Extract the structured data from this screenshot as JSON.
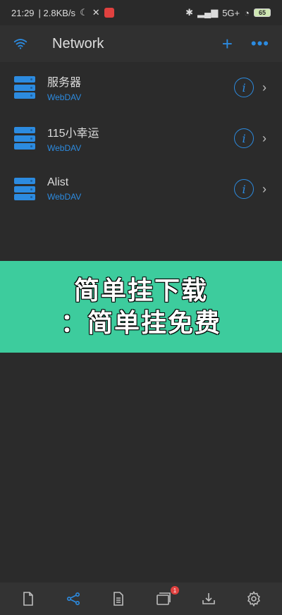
{
  "status_bar": {
    "time": "21:29",
    "speed": "| 2.8KB/s",
    "network": "5G+",
    "battery": "65"
  },
  "appbar": {
    "title": "Network"
  },
  "servers": [
    {
      "name": "服务器",
      "type": "WebDAV"
    },
    {
      "name": "115小幸运",
      "type": "WebDAV"
    },
    {
      "name": "Alist",
      "type": "WebDAV"
    }
  ],
  "banner": {
    "line1": "简单挂下载",
    "line2": "：简单挂免费"
  },
  "bottom_tabs": [
    {
      "icon": "file-icon",
      "active": false
    },
    {
      "icon": "share-network-icon",
      "active": true
    },
    {
      "icon": "document-icon",
      "active": false
    },
    {
      "icon": "windows-icon",
      "active": false,
      "badge": "1"
    },
    {
      "icon": "download-icon",
      "active": false
    },
    {
      "icon": "settings-gear-icon",
      "active": false
    }
  ],
  "colors": {
    "accent": "#2c8be0",
    "background": "#2b2b2b",
    "banner": "#3dcc9d",
    "badge": "#e0413f"
  }
}
